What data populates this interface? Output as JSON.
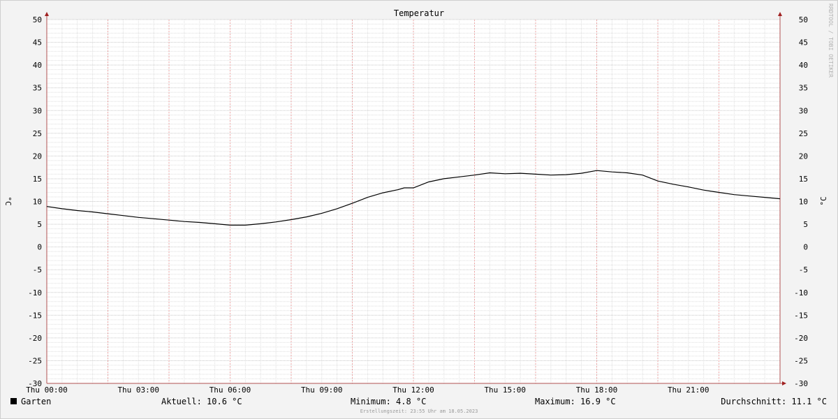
{
  "chart_data": {
    "type": "line",
    "title": "Temperatur",
    "ylabel": "°C",
    "ylim": [
      -30,
      50
    ],
    "y_ticks": [
      50,
      45,
      40,
      35,
      30,
      25,
      20,
      15,
      10,
      5,
      0,
      -5,
      -10,
      -15,
      -20,
      -25,
      -30
    ],
    "xlim_hours": [
      0,
      24
    ],
    "x_ticks": [
      {
        "label": "Thu 00:00",
        "hour": 0
      },
      {
        "label": "Thu 03:00",
        "hour": 3
      },
      {
        "label": "Thu 06:00",
        "hour": 6
      },
      {
        "label": "Thu 09:00",
        "hour": 9
      },
      {
        "label": "Thu 12:00",
        "hour": 12
      },
      {
        "label": "Thu 15:00",
        "hour": 15
      },
      {
        "label": "Thu 18:00",
        "hour": 18
      },
      {
        "label": "Thu 21:00",
        "hour": 21
      }
    ],
    "grid": true,
    "series": [
      {
        "name": "Garten",
        "color": "#000000",
        "x": [
          0,
          0.5,
          1,
          1.5,
          2,
          2.5,
          3,
          3.5,
          4,
          4.5,
          5,
          5.5,
          6,
          6.5,
          7,
          7.5,
          8,
          8.5,
          9,
          9.5,
          10,
          10.5,
          11,
          11.5,
          11.7,
          12,
          12.5,
          13,
          13.5,
          14,
          14.5,
          15,
          15.5,
          16,
          16.5,
          17,
          17.5,
          18,
          18.5,
          19,
          19.5,
          20,
          20.5,
          21,
          21.5,
          22,
          22.5,
          23,
          23.5,
          24
        ],
        "values": [
          8.9,
          8.4,
          8.0,
          7.7,
          7.3,
          6.9,
          6.5,
          6.2,
          5.9,
          5.6,
          5.4,
          5.1,
          4.8,
          4.8,
          5.1,
          5.5,
          6.0,
          6.6,
          7.4,
          8.4,
          9.6,
          10.9,
          11.9,
          12.6,
          13.0,
          13.0,
          14.3,
          15.0,
          15.4,
          15.8,
          16.3,
          16.1,
          16.2,
          16.0,
          15.8,
          15.9,
          16.2,
          16.8,
          16.5,
          16.3,
          15.8,
          14.5,
          13.8,
          13.2,
          12.5,
          12.0,
          11.5,
          11.2,
          10.9,
          10.6
        ]
      }
    ]
  },
  "legend": {
    "series_name": "Garten",
    "current": "Aktuell: 10.6 °C",
    "minimum": "Minimum: 4.8 °C",
    "maximum": "Maximum: 16.9 °C",
    "average": "Durchschnitt: 11.1 °C"
  },
  "footer": "Erstellungszeit: 23:55 Uhr am 18.05.2023",
  "watermark": "RRDTOOL / TOBI OETIKER"
}
